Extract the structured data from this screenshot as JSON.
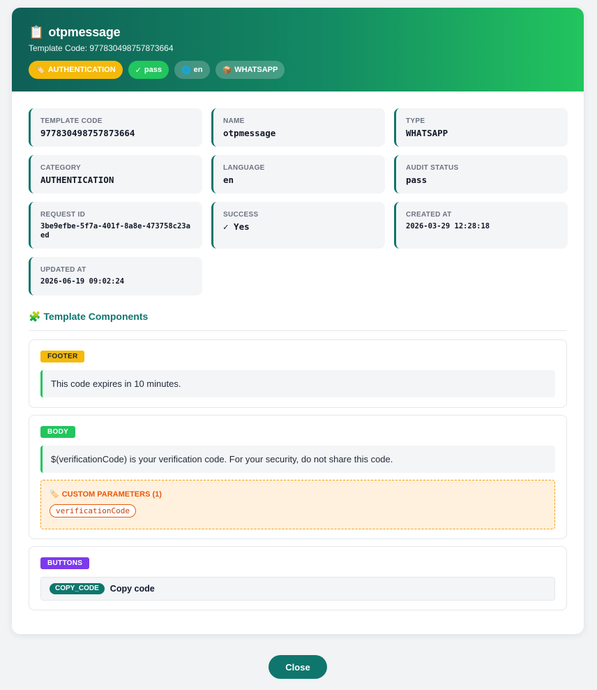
{
  "header": {
    "icon": "clipboard-icon",
    "title": "otpmessage",
    "subtitle": "Template Code: 977830498757873664",
    "chips": {
      "category": {
        "icon": "tag-icon",
        "icon_glyph": "🏷️",
        "label": "AUTHENTICATION"
      },
      "status": {
        "icon": "check-icon",
        "icon_glyph": "✓",
        "label": "pass"
      },
      "language": {
        "icon": "globe-icon",
        "icon_glyph": "🌐",
        "label": "en"
      },
      "type": {
        "icon": "package-icon",
        "icon_glyph": "📦",
        "label": "WHATSAPP"
      }
    },
    "title_glyph": "📋"
  },
  "fields": {
    "template_code": {
      "label": "TEMPLATE CODE",
      "value": "977830498757873664"
    },
    "name": {
      "label": "NAME",
      "value": "otpmessage"
    },
    "type": {
      "label": "TYPE",
      "value": "WHATSAPP"
    },
    "category": {
      "label": "CATEGORY",
      "value": "AUTHENTICATION"
    },
    "language": {
      "label": "LANGUAGE",
      "value": "en"
    },
    "audit_status": {
      "label": "AUDIT STATUS",
      "value": "pass"
    },
    "request_id": {
      "label": "REQUEST ID",
      "value": "3be9efbe-5f7a-401f-8a8e-473758c23aed"
    },
    "success": {
      "label": "SUCCESS",
      "value": "✓ Yes"
    },
    "created_at": {
      "label": "CREATED AT",
      "value": "2026-03-29 12:28:18"
    },
    "updated_at": {
      "label": "UPDATED AT",
      "value": "2026-06-19 09:02:24"
    }
  },
  "components_section": {
    "icon": "puzzle-icon",
    "icon_glyph": "🧩",
    "title": "Template Components"
  },
  "components": {
    "footer": {
      "tag": "FOOTER",
      "text": "This code expires in 10 minutes."
    },
    "body": {
      "tag": "BODY",
      "text": "$(verificationCode) is your verification code. For your security, do not share this code.",
      "params_icon": "tag-icon",
      "params_icon_glyph": "🏷️",
      "params_title": "CUSTOM PARAMETERS (1)",
      "params": [
        "verificationCode"
      ]
    },
    "buttons": {
      "tag": "BUTTONS",
      "items": [
        {
          "type": "COPY_CODE",
          "label": "Copy code"
        }
      ]
    }
  },
  "footer_actions": {
    "close_label": "Close"
  },
  "colors": {
    "header_gradient_start": "#0f5f57",
    "header_gradient_end": "#22c55e",
    "accent": "#0f766e",
    "authentication_chip": "#f5b90a",
    "pass_chip": "#22c55e",
    "buttons_tag": "#7c3aed",
    "params_accent": "#ea580c"
  }
}
